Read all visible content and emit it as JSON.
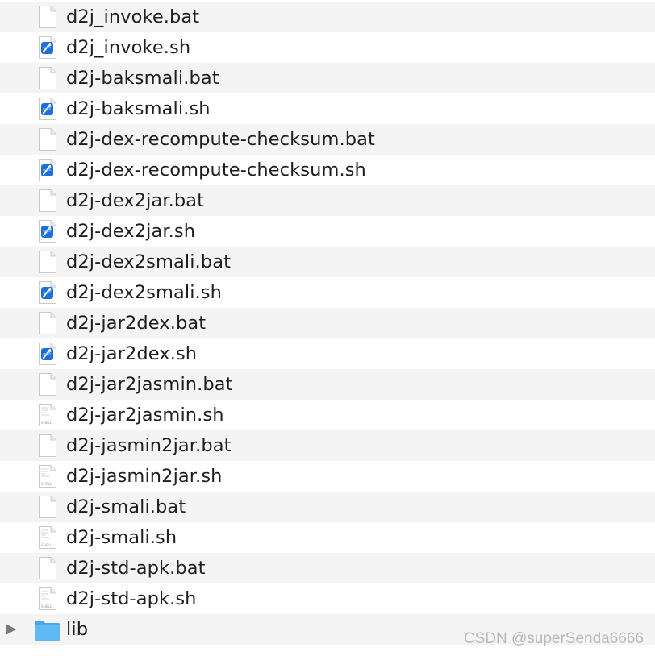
{
  "files": [
    {
      "name": "d2j_invoke.bat",
      "icon": "blank-document-icon"
    },
    {
      "name": "d2j_invoke.sh",
      "icon": "xcode-script-icon"
    },
    {
      "name": "d2j-baksmali.bat",
      "icon": "blank-document-icon"
    },
    {
      "name": "d2j-baksmali.sh",
      "icon": "xcode-script-icon"
    },
    {
      "name": "d2j-dex-recompute-checksum.bat",
      "icon": "blank-document-icon"
    },
    {
      "name": "d2j-dex-recompute-checksum.sh",
      "icon": "xcode-script-icon"
    },
    {
      "name": "d2j-dex2jar.bat",
      "icon": "blank-document-icon"
    },
    {
      "name": "d2j-dex2jar.sh",
      "icon": "xcode-script-icon"
    },
    {
      "name": "d2j-dex2smali.bat",
      "icon": "blank-document-icon"
    },
    {
      "name": "d2j-dex2smali.sh",
      "icon": "xcode-script-icon"
    },
    {
      "name": "d2j-jar2dex.bat",
      "icon": "blank-document-icon"
    },
    {
      "name": "d2j-jar2dex.sh",
      "icon": "xcode-script-icon"
    },
    {
      "name": "d2j-jar2jasmin.bat",
      "icon": "blank-document-icon"
    },
    {
      "name": "d2j-jar2jasmin.sh",
      "icon": "shell-script-icon"
    },
    {
      "name": "d2j-jasmin2jar.bat",
      "icon": "blank-document-icon"
    },
    {
      "name": "d2j-jasmin2jar.sh",
      "icon": "shell-script-icon"
    },
    {
      "name": "d2j-smali.bat",
      "icon": "blank-document-icon"
    },
    {
      "name": "d2j-smali.sh",
      "icon": "shell-script-icon"
    },
    {
      "name": "d2j-std-apk.bat",
      "icon": "blank-document-icon"
    },
    {
      "name": "d2j-std-apk.sh",
      "icon": "shell-script-icon"
    }
  ],
  "folder": {
    "name": "lib",
    "icon": "folder-icon",
    "expanded": false
  },
  "watermark": "CSDN @superSenda6666",
  "colors": {
    "stripe": "#f4f4f4",
    "folder": "#5fb9f3",
    "text": "#1e1e1e"
  }
}
